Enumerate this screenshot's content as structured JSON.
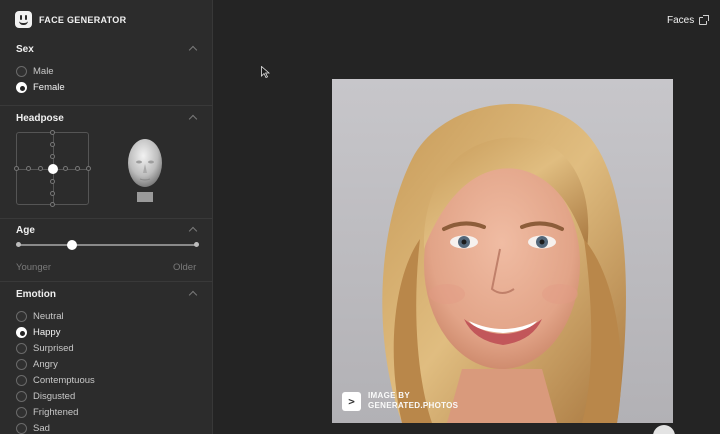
{
  "app": {
    "name": "FACE GENERATOR"
  },
  "nav": {
    "faces_link": "Faces"
  },
  "sex": {
    "title": "Sex",
    "options": [
      {
        "label": "Male",
        "selected": false
      },
      {
        "label": "Female",
        "selected": true
      }
    ]
  },
  "headpose": {
    "title": "Headpose"
  },
  "age": {
    "title": "Age",
    "min_label": "Younger",
    "max_label": "Older",
    "value_fraction": 0.3
  },
  "emotion": {
    "title": "Emotion",
    "options": [
      {
        "label": "Neutral",
        "selected": false
      },
      {
        "label": "Happy",
        "selected": true
      },
      {
        "label": "Surprised",
        "selected": false
      },
      {
        "label": "Angry",
        "selected": false
      },
      {
        "label": "Contemptuous",
        "selected": false
      },
      {
        "label": "Disgusted",
        "selected": false
      },
      {
        "label": "Frightened",
        "selected": false
      },
      {
        "label": "Sad",
        "selected": false
      }
    ]
  },
  "photo": {
    "watermark_line1": "IMAGE BY",
    "watermark_line2": "GENERATED.PHOTOS",
    "watermark_logo": ">"
  },
  "colors": {
    "sidebar_bg": "#2c2c2c",
    "main_bg": "#242424",
    "accent": "#ffffff"
  }
}
